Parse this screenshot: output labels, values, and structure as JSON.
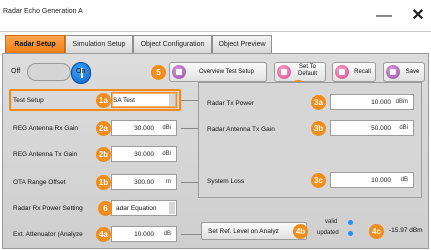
{
  "window": {
    "title": "Radar Echo Generation A",
    "minimize_glyph": "—",
    "close_glyph": "✕"
  },
  "tabs": [
    {
      "label": "Radar Setup",
      "active": true
    },
    {
      "label": "Simulation Setup",
      "active": false
    },
    {
      "label": "Object Configuration",
      "active": false
    },
    {
      "label": "Object Preview",
      "active": false
    }
  ],
  "toolbar": {
    "off_label": "Off",
    "on_label": "On",
    "state": "on",
    "badge": "5",
    "overview_label": "Overview Test Setup",
    "set_default_line1": "Set To",
    "set_default_line2": "Default",
    "recall_label": "Recall",
    "save_label": "Save"
  },
  "left": {
    "test_setup": {
      "label": "Test Setup",
      "badge": "1a",
      "value": "SA Test"
    },
    "reg_rx": {
      "label": "REG Antenna Rx Gain",
      "badge": "2a",
      "value": "30.000",
      "unit": "dBi"
    },
    "reg_tx": {
      "label": "REG Antenna Tx Gain",
      "badge": "2b",
      "value": "30.000",
      "unit": "dBi"
    },
    "ota": {
      "label": "OTA Range Offset",
      "badge": "1b",
      "value": "300.00",
      "unit": "m"
    },
    "rx_power": {
      "label": "Radar Rx Power Setting",
      "badge": "6",
      "value": "adar Equation"
    },
    "ext_att": {
      "label": "Ext. Attenuator (Analyze",
      "badge": "4a",
      "value": "10.000",
      "unit": "dB"
    }
  },
  "right": {
    "badge_top": "3",
    "tx_power": {
      "label": "Radar Tx Power",
      "badge": "3a",
      "value": "10.000",
      "unit": "dBm"
    },
    "tx_gain": {
      "label": "Radar Antenna Tx Gain",
      "badge": "3b",
      "value": "50.000",
      "unit": "dBi"
    },
    "sys_loss": {
      "label": "System Loss",
      "badge": "3c",
      "value": "10.000",
      "unit": "dB"
    }
  },
  "bottom": {
    "set_ref_label": "Set Ref. Level on Analyz",
    "set_ref_badge": "4b",
    "valid_label": "valid",
    "updated_label": "updated",
    "result_badge": "4c",
    "result_value": "-15.97 dBm"
  },
  "colors": {
    "accent": "#f28c1a",
    "toggle": "#0a63c4",
    "status_dot": "#2a8ef0"
  }
}
